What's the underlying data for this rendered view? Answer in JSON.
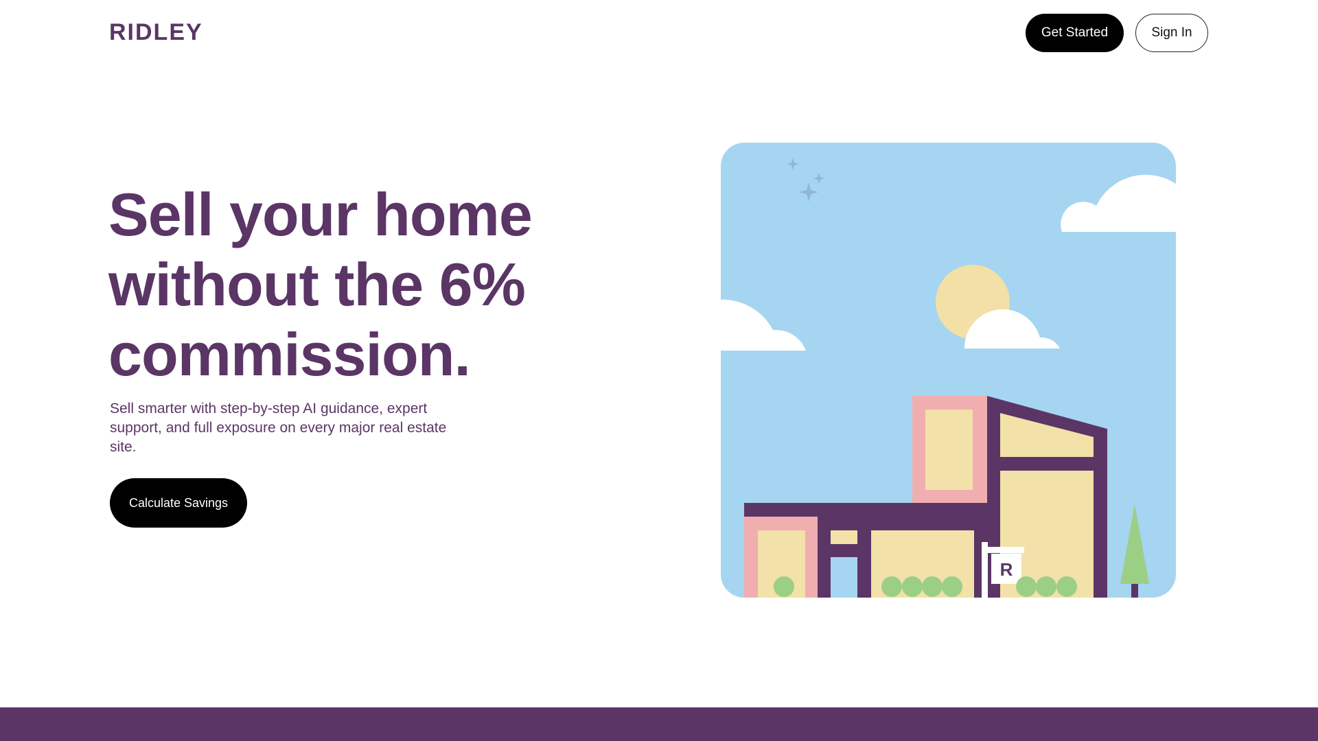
{
  "header": {
    "logo": "RIDLEY",
    "get_started_label": "Get Started",
    "sign_in_label": "Sign In"
  },
  "hero": {
    "title_lines": [
      "Sell your home",
      "without the 6%",
      "commission."
    ],
    "subtitle": "Sell smarter with step-by-step AI guidance, expert support, and full exposure on every major real estate site.",
    "cta_label": "Calculate Savings"
  },
  "illustration": {
    "sign_letter": "R",
    "icons": [
      "sparkle-icon",
      "cloud-icon",
      "sun-icon",
      "house-icon",
      "tree-icon"
    ]
  },
  "colors": {
    "brand_purple": "#5b3566",
    "sky_blue": "#a5d5f1",
    "sun_yellow": "#f3e0a6",
    "wall_yellow": "#f2e1a8",
    "wall_pink": "#f1aeb0",
    "bush_green": "#9ccf86",
    "cloud_white": "#ffffff",
    "button_black": "#000000"
  }
}
